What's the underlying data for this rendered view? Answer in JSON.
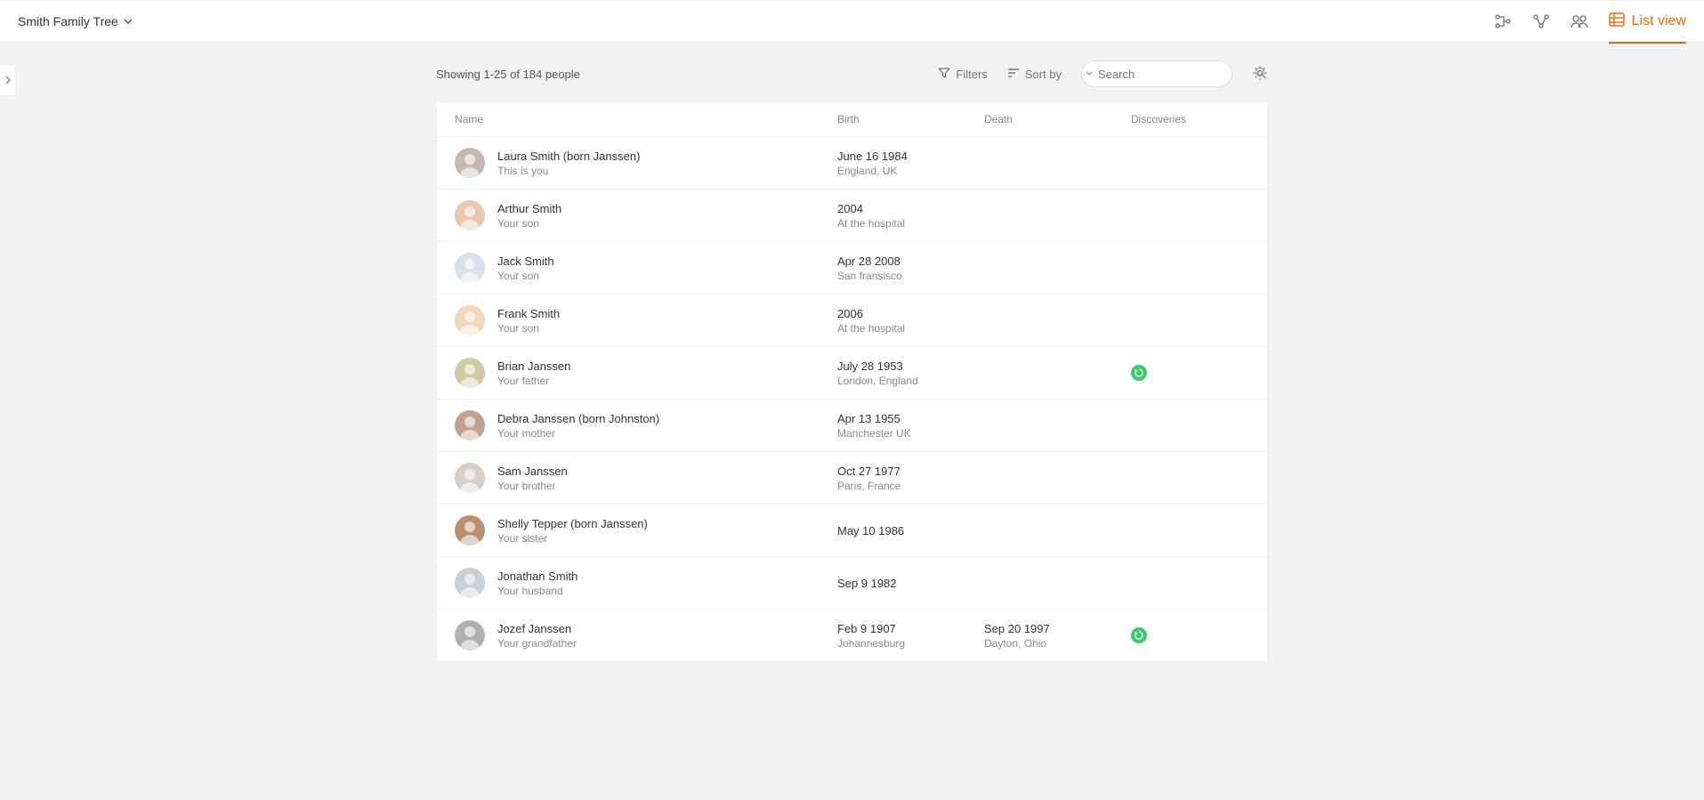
{
  "header": {
    "tree_title": "Smith Family Tree",
    "listview_label": "List view"
  },
  "controls": {
    "showing_text": "Showing 1-25 of 184 people",
    "filters_label": "Filters",
    "sortby_label": "Sort by",
    "search_placeholder": "Search"
  },
  "table": {
    "headers": {
      "name": "Name",
      "birth": "Birth",
      "death": "Death",
      "discoveries": "Discoveries"
    },
    "rows": [
      {
        "name": "Laura Smith (born Janssen)",
        "sub": "This is you",
        "birth": "June 16 1984",
        "birth_sub": "England, UK",
        "death": "",
        "death_sub": "",
        "discovery": ""
      },
      {
        "name": "Arthur Smith",
        "sub": "Your son",
        "birth": "2004",
        "birth_sub": "At the hospital",
        "death": "",
        "death_sub": "",
        "discovery": ""
      },
      {
        "name": "Jack Smith",
        "sub": "Your son",
        "birth": "Apr 28 2008",
        "birth_sub": "San fransisco",
        "death": "",
        "death_sub": "",
        "discovery": ""
      },
      {
        "name": "Frank Smith",
        "sub": "Your son",
        "birth": "2006",
        "birth_sub": "At the hospital",
        "death": "",
        "death_sub": "",
        "discovery": ""
      },
      {
        "name": "Brian Janssen",
        "sub": "Your father",
        "birth": "July 28 1953",
        "birth_sub": "London, England",
        "death": "",
        "death_sub": "",
        "discovery": "green"
      },
      {
        "name": "Debra Janssen (born Johnston)",
        "sub": "Your mother",
        "birth": "Apr 13 1955",
        "birth_sub": "Manchester UK",
        "death": "",
        "death_sub": "",
        "discovery": ""
      },
      {
        "name": "Sam Janssen",
        "sub": "Your brother",
        "birth": "Oct 27 1977",
        "birth_sub": "Paris, France",
        "death": "",
        "death_sub": "",
        "discovery": ""
      },
      {
        "name": "Shelly Tepper (born Janssen)",
        "sub": "Your sister",
        "birth": "May 10 1986",
        "birth_sub": "",
        "death": "",
        "death_sub": "",
        "discovery": ""
      },
      {
        "name": "Jonathan Smith",
        "sub": "Your husband",
        "birth": "Sep 9 1982",
        "birth_sub": "",
        "death": "",
        "death_sub": "",
        "discovery": ""
      },
      {
        "name": "Jozef Janssen",
        "sub": "Your grandfather",
        "birth": "Feb 9 1907",
        "birth_sub": "Johannesburg",
        "death": "Sep 20 1997",
        "death_sub": "Dayton, Ohio",
        "discovery": "green"
      }
    ]
  },
  "avatar_colors": [
    "#c7b8b0",
    "#e8c8b0",
    "#d8e0e8",
    "#f0d8b8",
    "#d0c8a0",
    "#c0a090",
    "#d8d0c8",
    "#b89070",
    "#c8d0d8",
    "#b0b0b0"
  ]
}
